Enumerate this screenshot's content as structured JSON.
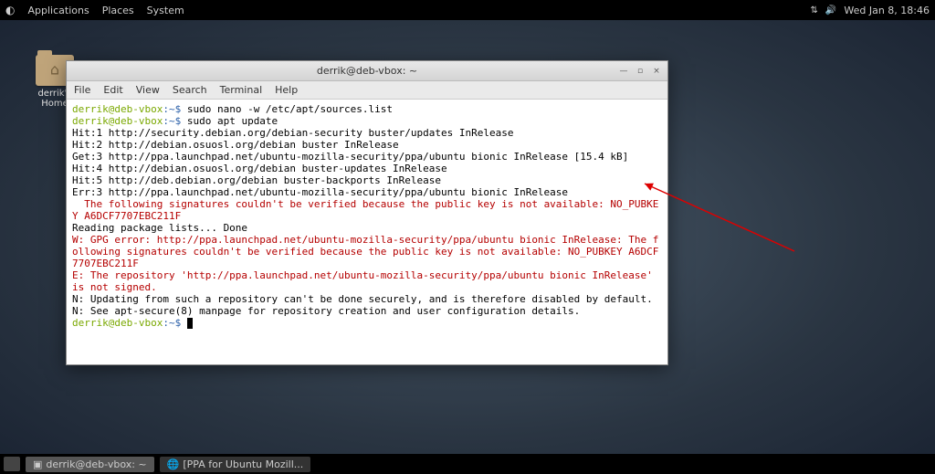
{
  "top_panel": {
    "applications": "Applications",
    "places": "Places",
    "system": "System",
    "clock": "Wed Jan  8, 18:46"
  },
  "desktop": {
    "home_label": "derrik's Home"
  },
  "window": {
    "title": "derrik@deb-vbox: ~",
    "menu": {
      "file": "File",
      "edit": "Edit",
      "view": "View",
      "search": "Search",
      "terminal": "Terminal",
      "help": "Help"
    }
  },
  "terminal": {
    "user_host": "derrik@deb-vbox",
    "path": ":~$",
    "cmd1": " sudo nano -w /etc/apt/sources.list",
    "cmd2": " sudo apt update",
    "line3": "Hit:1 http://security.debian.org/debian-security buster/updates InRelease",
    "line4": "Hit:2 http://debian.osuosl.org/debian buster InRelease",
    "line5": "Get:3 http://ppa.launchpad.net/ubuntu-mozilla-security/ppa/ubuntu bionic InRelease [15.4 kB]",
    "line6": "Hit:4 http://debian.osuosl.org/debian buster-updates InRelease",
    "line7": "Hit:5 http://deb.debian.org/debian buster-backports InRelease",
    "line8": "Err:3 http://ppa.launchpad.net/ubuntu-mozilla-security/ppa/ubuntu bionic InRelease",
    "line9": "  The following signatures couldn't be verified because the public key is not available: NO_PUBKEY A6DCF7707EBC211F",
    "line10": "Reading package lists... Done",
    "line11": "W: GPG error: http://ppa.launchpad.net/ubuntu-mozilla-security/ppa/ubuntu bionic InRelease: The following signatures couldn't be verified because the public key is not available: NO_PUBKEY A6DCF7707EBC211F",
    "line12": "E: The repository 'http://ppa.launchpad.net/ubuntu-mozilla-security/ppa/ubuntu bionic InRelease' is not signed.",
    "line13": "N: Updating from such a repository can't be done securely, and is therefore disabled by default.",
    "line14": "N: See apt-secure(8) manpage for repository creation and user configuration details."
  },
  "bottom_panel": {
    "task1": "derrik@deb-vbox: ~",
    "task2": "[PPA for Ubuntu Mozill..."
  }
}
